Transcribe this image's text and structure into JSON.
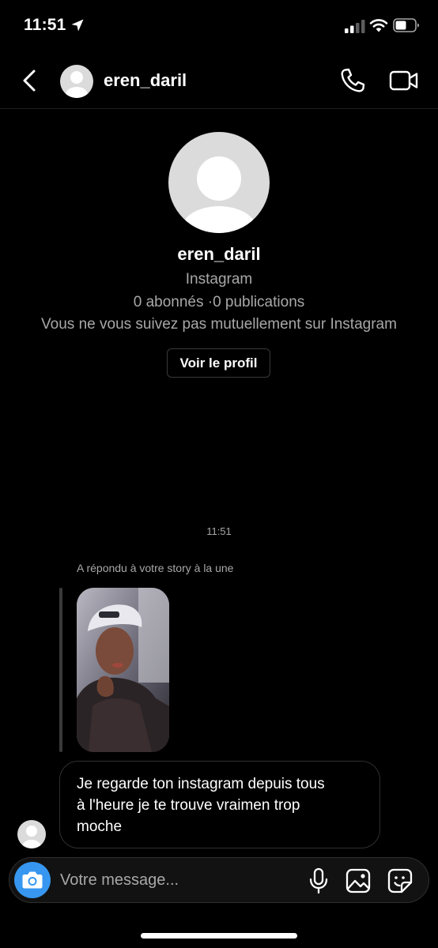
{
  "status_bar": {
    "time": "11:51",
    "icons": [
      "location-arrow-icon",
      "signal-icon",
      "wifi-icon",
      "battery-icon"
    ]
  },
  "header": {
    "username": "eren_daril",
    "icons": [
      "back-icon",
      "avatar",
      "phone-call-icon",
      "video-call-icon"
    ]
  },
  "profile": {
    "name": "eren_daril",
    "platform": "Instagram",
    "stats": "0 abonnés ·0 publications",
    "relation": "Vous ne vous suivez pas mutuellement sur Instagram",
    "view_profile_label": "Voir le profil"
  },
  "conversation": {
    "timestamp": "11:51",
    "reply_label": "A répondu à votre story à la une",
    "story_thumbnail": "story-photo",
    "message_lines": [
      "Je regarde ton instagram depuis tous",
      "à l'heure je te trouve vraimen trop",
      "moche"
    ]
  },
  "composer": {
    "placeholder": "Votre message...",
    "icons": [
      "camera-icon",
      "microphone-icon",
      "gallery-icon",
      "sticker-icon"
    ]
  },
  "colors": {
    "background": "#000000",
    "accent_blue": "#3797f0",
    "secondary_text": "#a8a8a8",
    "avatar_placeholder": "#dbdbdb"
  }
}
